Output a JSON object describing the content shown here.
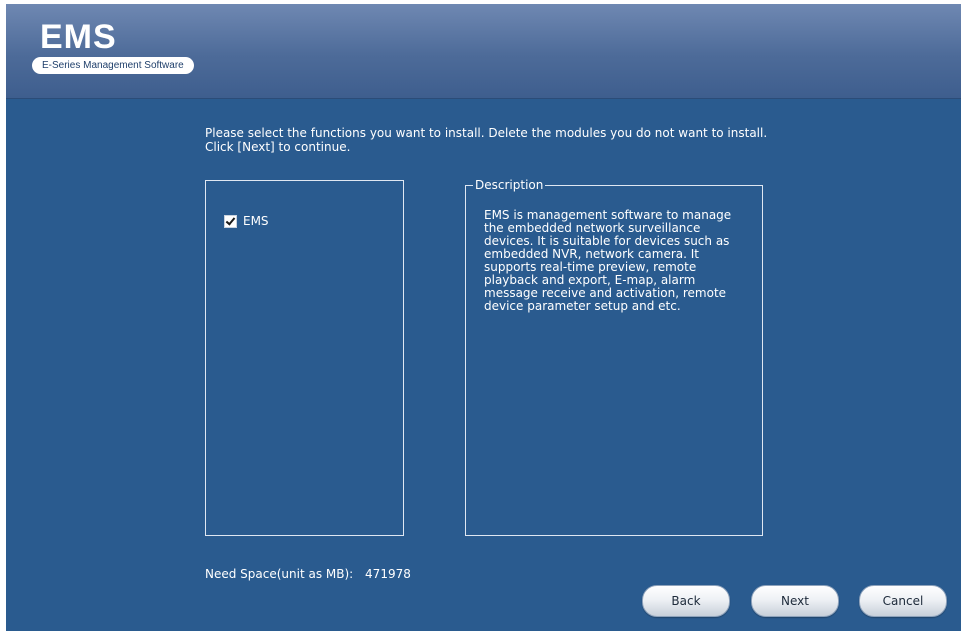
{
  "header": {
    "title": "EMS",
    "subtitle": "E-Series Management Software"
  },
  "instructions": "Please select the functions you want to install. Delete the modules you do not want to install. Click [Next] to continue.",
  "modules": [
    {
      "label": "EMS",
      "checked": true
    }
  ],
  "description": {
    "legend": "Description",
    "text": "EMS is management software to manage the embedded network surveillance devices. It is suitable for devices such as embedded NVR, network camera. It supports real-time preview, remote playback and export, E-map, alarm message receive and activation, remote device parameter setup and etc."
  },
  "space": {
    "label": "Need Space(unit as MB):",
    "value": "471978"
  },
  "buttons": {
    "back": "Back",
    "next": "Next",
    "cancel": "Cancel"
  },
  "colors": {
    "background": "#2a5b8f",
    "header_top": "#6f88b2",
    "header_bottom": "#3e5e8e",
    "text": "#ffffff"
  }
}
